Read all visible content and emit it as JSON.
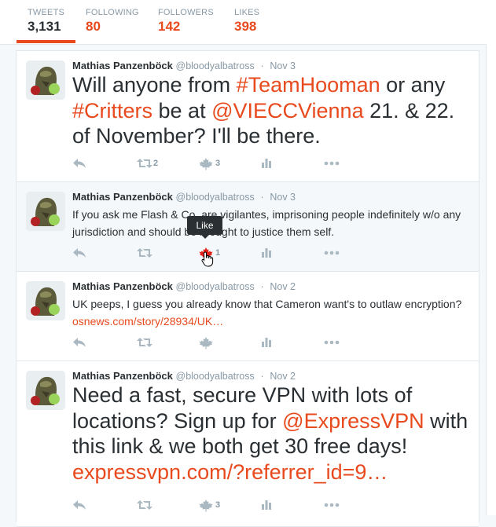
{
  "profile_nav": {
    "tweets": {
      "label": "TWEETS",
      "value": "3,131"
    },
    "following": {
      "label": "FOLLOWING",
      "value": "80"
    },
    "followers": {
      "label": "FOLLOWERS",
      "value": "142"
    },
    "likes": {
      "label": "LIKES",
      "value": "398"
    }
  },
  "colors": {
    "accent": "#e84a1e",
    "text": "#292f33",
    "muted": "#8899a6",
    "icon": "#aab8c2"
  },
  "tooltip": "Like",
  "tweets": [
    {
      "fullname": "Mathias Panzenböck",
      "username": "@bloodyalbatross",
      "sep": "·",
      "time": "Nov 3",
      "parts": [
        "Will anyone from ",
        "#TeamHooman",
        " or any ",
        "#Critters",
        " be at ",
        "@VIECCVienna",
        " 21. & 22. of November? I'll be there."
      ],
      "retweets": "2",
      "likes": "3"
    },
    {
      "fullname": "Mathias Panzenböck",
      "username": "@bloodyalbatross",
      "sep": "·",
      "time": "Nov 3",
      "parts": [
        "If you ask me Flash & Co. are vigilantes, imprisoning people indefinitely w/o any jurisdiction and should be brought to justice them self."
      ],
      "retweets": "",
      "likes": "1"
    },
    {
      "fullname": "Mathias Panzenböck",
      "username": "@bloodyalbatross",
      "sep": "·",
      "time": "Nov 2",
      "parts": [
        "UK peeps, I guess you already know that Cameron want's to outlaw encryption? ",
        "osnews.com/story/28934/UK…"
      ],
      "retweets": "",
      "likes": ""
    },
    {
      "fullname": "Mathias Panzenböck",
      "username": "@bloodyalbatross",
      "sep": "·",
      "time": "Nov 2",
      "parts": [
        "Need a fast, secure VPN with lots of locations? Sign up for ",
        "@ExpressVPN",
        " with this link & we both get 30 free days! ",
        "expressvpn.com/?referrer_id=9…"
      ],
      "retweets": "",
      "likes": "3"
    }
  ],
  "icons": {
    "reply": "reply-icon",
    "retweet": "retweet-icon",
    "like": "maple-leaf-like-icon",
    "analytics": "analytics-bar-chart-icon",
    "more": "more-dots-icon"
  }
}
